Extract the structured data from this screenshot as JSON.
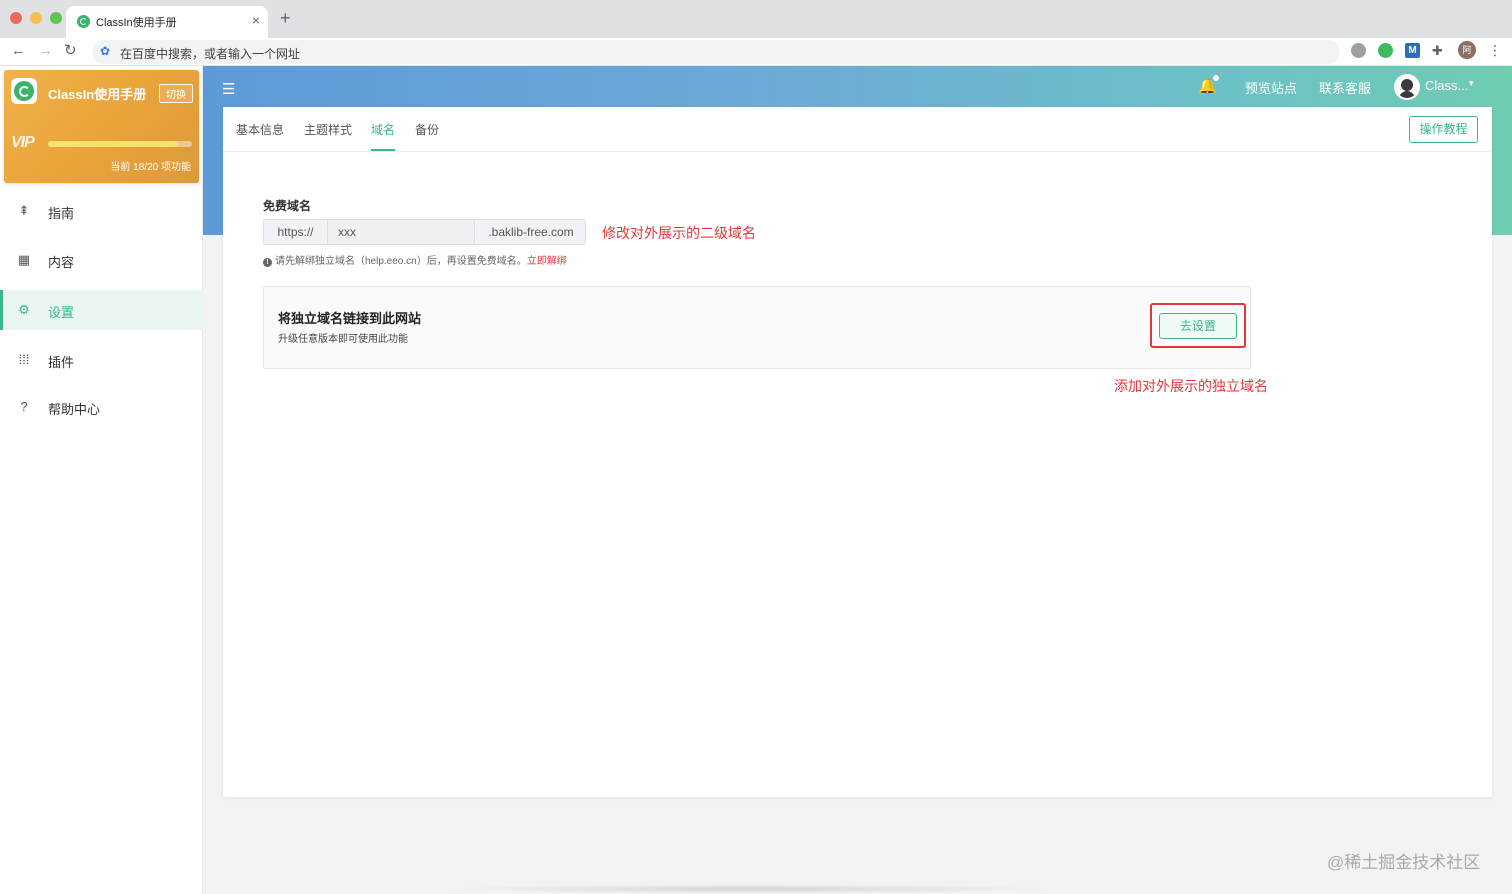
{
  "browser": {
    "tab_title": "ClassIn使用手册",
    "tab_close": "×",
    "new_tab": "+",
    "omnibox_placeholder": "在百度中搜索，或者输入一个网址",
    "nav_back": "←",
    "nav_forward": "→",
    "nav_reload": "↻",
    "extensions": [
      "globe-icon",
      "check-icon",
      "m-icon",
      "puzzle-icon",
      "profile-icon"
    ],
    "ext_m_label": "M",
    "ext_profile_label": "阿",
    "menu": "⋮"
  },
  "sidebar": {
    "card": {
      "title": "ClassIn使用手册",
      "switch_label": "切换",
      "vip_label": "VIP",
      "usage_text": "当前 18/20 项功能",
      "usage_progress": 0.9
    },
    "items": [
      {
        "label": "指南",
        "icon": "guide-icon",
        "glyph": "⇞"
      },
      {
        "label": "内容",
        "icon": "grid-icon",
        "glyph": "▦"
      },
      {
        "label": "设置",
        "icon": "gear-icon",
        "glyph": "⚙"
      },
      {
        "label": "插件",
        "icon": "apps-icon",
        "glyph": "⁞⁞⁞"
      },
      {
        "label": "帮助中心",
        "icon": "help-icon",
        "glyph": "?"
      }
    ],
    "active_item": "设置"
  },
  "header": {
    "menu_glyph": "☰",
    "bell_glyph": "🔔",
    "preview_label": "预览站点",
    "support_label": "联系客服",
    "user_name": "Class...",
    "caret": "▾"
  },
  "settings": {
    "tabs": [
      {
        "label": "基本信息"
      },
      {
        "label": "主题样式"
      },
      {
        "label": "域名"
      },
      {
        "label": "备份"
      }
    ],
    "active_tab": "域名",
    "tutorial_label": "操作教程",
    "free_domain": {
      "label": "免费域名",
      "prefix": "https://",
      "value": "xxx",
      "suffix": ".baklib-free.com",
      "hint_icon": "!",
      "hint_text": "请先解绑独立域名（help.eeo.cn）后，再设置免费域名。",
      "hint_link": "立即解绑"
    },
    "custom_domain": {
      "title": "将独立域名链接到此网站",
      "subtitle": "升级任意版本即可使用此功能",
      "button_label": "去设置"
    }
  },
  "annotations": {
    "note_subdomain": "修改对外展示的二级域名",
    "note_custom": "添加对外展示的独立域名"
  },
  "watermark": "@稀土掘金技术社区",
  "colors": {
    "accent": "#3bb58a",
    "annotation_red": "#e0393b",
    "card_orange": "#e9a43a"
  }
}
